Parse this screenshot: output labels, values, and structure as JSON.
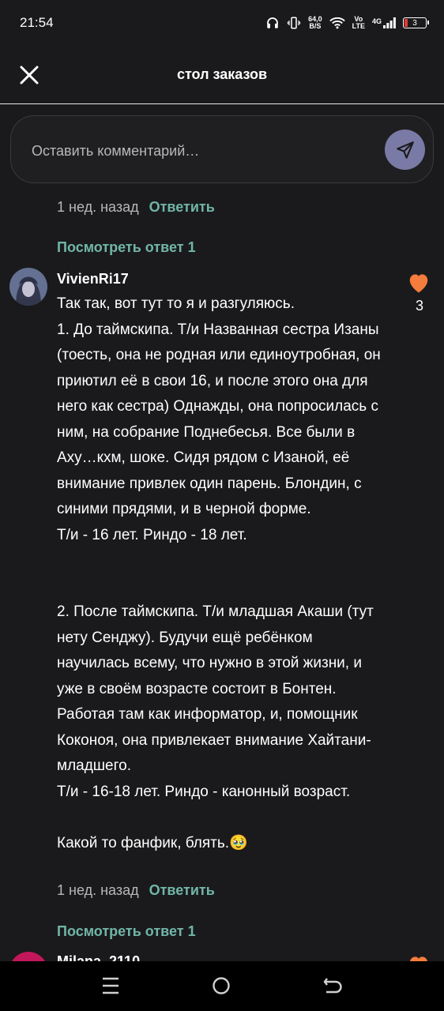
{
  "status_bar": {
    "time": "21:54",
    "net_speed": "64,0",
    "net_unit": "B/S",
    "volte_top": "Vo",
    "volte_bottom": "LTE",
    "signal_label": "4G",
    "battery": "3"
  },
  "header": {
    "title": "стол заказов"
  },
  "comment_input": {
    "placeholder": "Оставить комментарий…"
  },
  "prev_comment": {
    "time": "1 нед. назад",
    "reply_label": "Ответить",
    "view_replies": "Посмотреть ответ 1"
  },
  "comment": {
    "username": "VivienRi17",
    "likes": "3",
    "text": "Так так, вот тут то я и разгуляюсь.\n1. До таймскипа. Т/и Названная сестра Изаны (тоесть, она не родная или единоутробная, он приютил её в свои 16, и после этого она для него как сестра) Однажды, она попросилась с ним, на собрание Поднебесья. Все были в Аху…кхм, шоке. Сидя рядом с Изаной, её внимание привлек один парень. Блондин, с синими прядями, и в черной форме.\nТ/и - 16 лет. Риндо - 18 лет.\n\n\n2. После таймскипа. Т/и младшая Акаши (тут нету Сенджу). Будучи ещё ребёнком научилась всему, что нужно в этой жизни, и уже в своём возрасте состоит в Бонтен. Работая там как информатор, и, помощник Коконоя, она привлекает внимание Хайтани-младшего.\nТ/и - 16-18 лет. Риндо - канонный возраст.\n\nКакой то фанфик, блять.🥹",
    "time": "1 нед. назад",
    "reply_label": "Ответить",
    "view_replies": "Посмотреть ответ 1"
  },
  "next_comment": {
    "username": "Milana_2110"
  },
  "colors": {
    "accent": "#71b6a8",
    "like": "#f47c3c",
    "send": "#7a7aa6",
    "background": "#1a1a1c"
  },
  "icons": [
    "close-icon",
    "send-icon",
    "heart-icon",
    "menu-icon",
    "home-icon",
    "back-icon"
  ]
}
